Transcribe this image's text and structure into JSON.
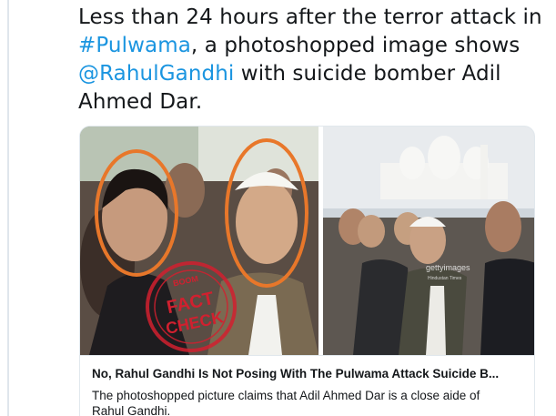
{
  "tweet": {
    "text_1": "Less than 24 hours after the terror attack in ",
    "hashtag": "#Pulwama",
    "text_2": ", a photoshopped image shows ",
    "mention": "@RahulGandhi",
    "text_3": " with suicide bomber Adil Ahmed Dar."
  },
  "card": {
    "title": "No, Rahul Gandhi Is Not Posing With The Pulwama Attack Suicide B...",
    "description": "The photoshopped picture claims that Adil Ahmed Dar is a close aide of Rahul Gandhi.",
    "stamp_brand": "BOOM",
    "stamp_line_1": "FACT",
    "stamp_line_2": "CHECK",
    "watermark_brand": "gettyimages",
    "watermark_credit": "Hindustan Times"
  },
  "colors": {
    "link": "#1b95e0",
    "highlight_circle": "#e8772a",
    "stamp_red": "#d1202f"
  }
}
